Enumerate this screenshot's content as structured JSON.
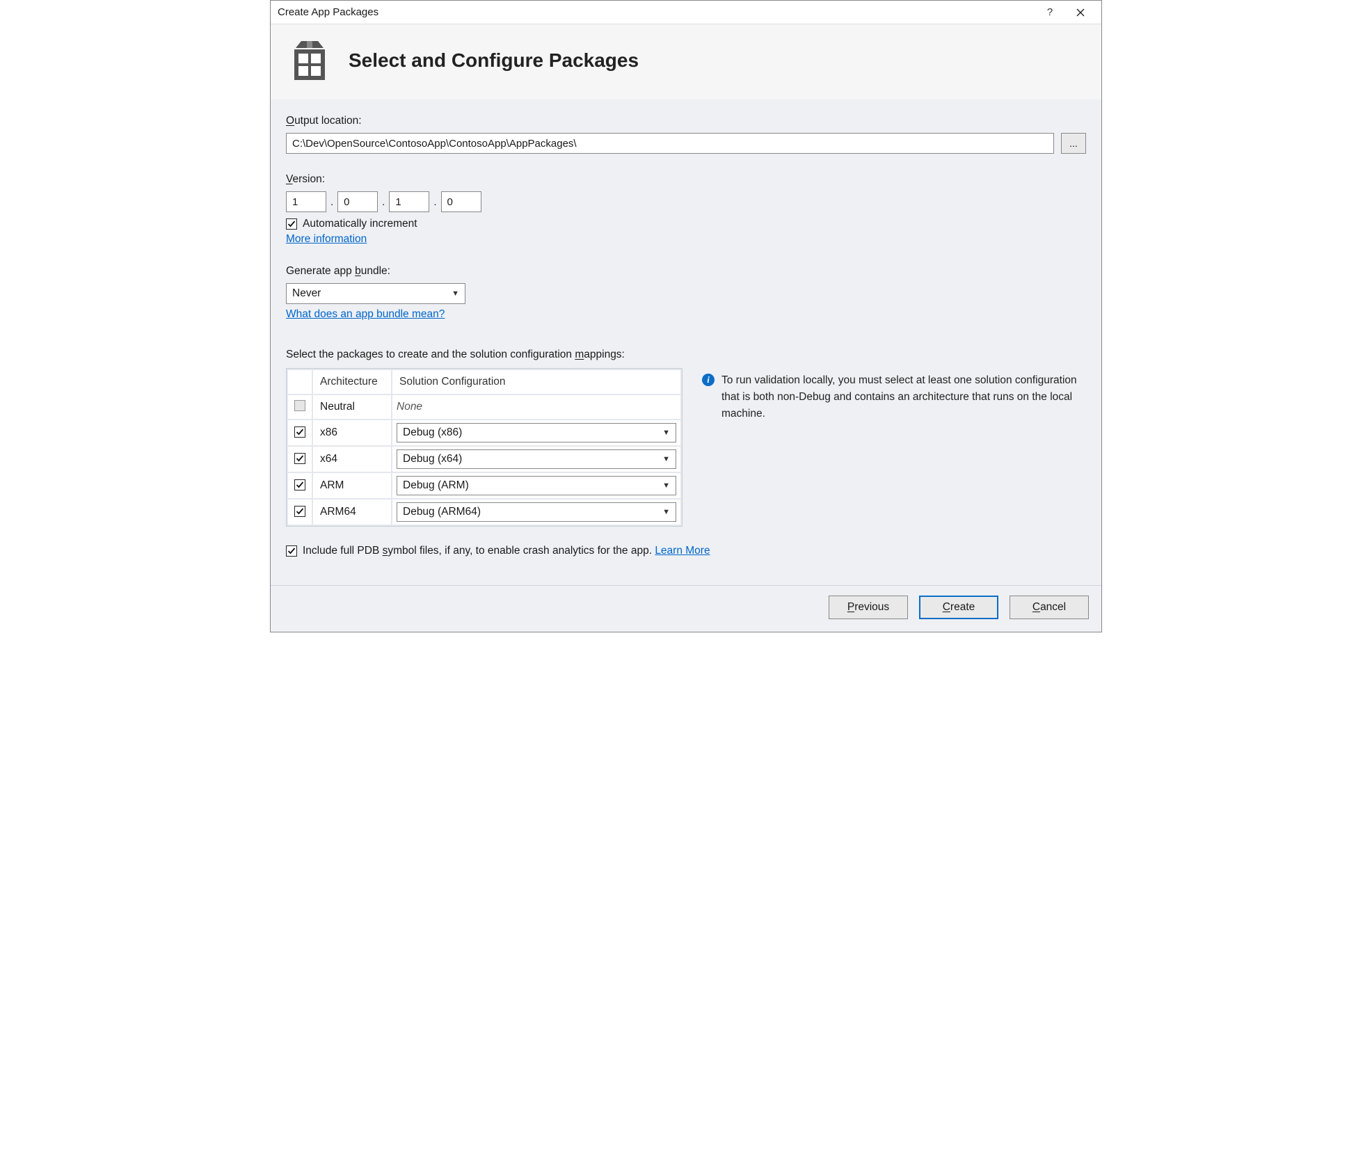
{
  "window": {
    "title": "Create App Packages",
    "help_tooltip": "?",
    "close_tooltip": "Close"
  },
  "header": {
    "title": "Select and Configure Packages"
  },
  "output": {
    "label_pre": "O",
    "label_post": "utput location:",
    "value": "C:\\Dev\\OpenSource\\ContosoApp\\ContosoApp\\AppPackages\\",
    "browse_label": "..."
  },
  "version": {
    "label_pre": "V",
    "label_post": "ersion:",
    "major": "1",
    "minor": "0",
    "build": "1",
    "revision": "0",
    "auto_increment_checked": true,
    "auto_increment_label": "Automatically increment",
    "more_info": "More information"
  },
  "bundle": {
    "label_pre": "Generate app ",
    "label_u": "b",
    "label_post": "undle:",
    "value": "Never",
    "help_link": "What does an app bundle mean?"
  },
  "packages": {
    "prompt_pre": "Select the packages to create and the solution configuration ",
    "prompt_u": "m",
    "prompt_post": "appings:",
    "col_arch": "Architecture",
    "col_cfg": "Solution Configuration",
    "rows": [
      {
        "checked": false,
        "disabled": true,
        "arch": "Neutral",
        "cfg": "None",
        "cfg_is_select": false
      },
      {
        "checked": true,
        "disabled": false,
        "arch": "x86",
        "cfg": "Debug (x86)",
        "cfg_is_select": true
      },
      {
        "checked": true,
        "disabled": false,
        "arch": "x64",
        "cfg": "Debug (x64)",
        "cfg_is_select": true
      },
      {
        "checked": true,
        "disabled": false,
        "arch": "ARM",
        "cfg": "Debug (ARM)",
        "cfg_is_select": true
      },
      {
        "checked": true,
        "disabled": false,
        "arch": "ARM64",
        "cfg": "Debug (ARM64)",
        "cfg_is_select": true
      }
    ],
    "info_text": "To run validation locally, you must select at least one solution configuration that is both non-Debug and contains an architecture that runs on the local machine."
  },
  "pdb": {
    "checked": true,
    "label_pre": "Include full PDB ",
    "label_u": "s",
    "label_post": "ymbol files, if any, to enable crash analytics for the app. ",
    "learn_more": "Learn More"
  },
  "footer": {
    "previous_u": "P",
    "previous_post": "revious",
    "create_u": "C",
    "create_post": "reate",
    "cancel_u": "C",
    "cancel_post": "ancel"
  }
}
